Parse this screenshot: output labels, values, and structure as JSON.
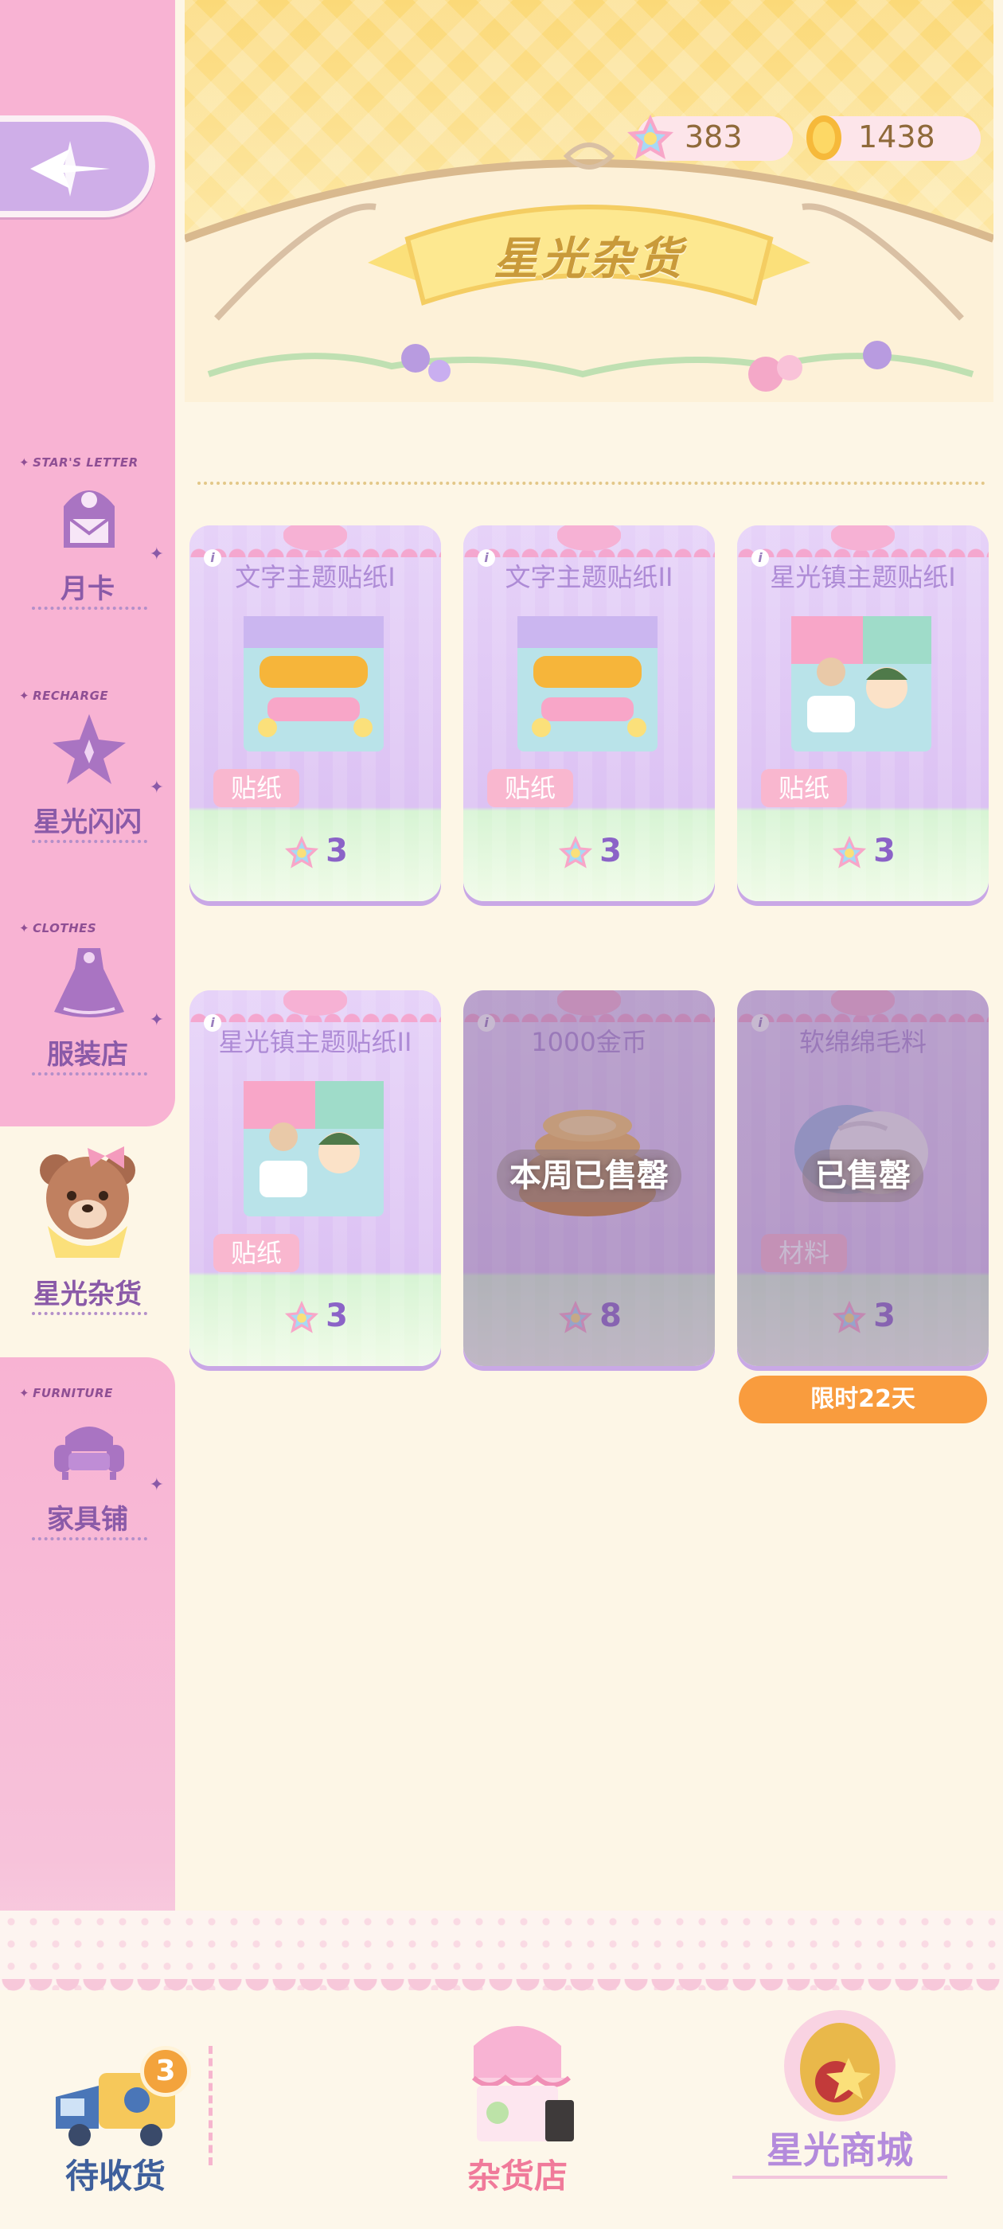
{
  "currency": {
    "stars": "383",
    "coins": "1438"
  },
  "banner": {
    "title": "星光杂货"
  },
  "sidebar": {
    "items": [
      {
        "tag": "STAR'S LETTER",
        "label": "月卡"
      },
      {
        "tag": "RECHARGE",
        "label": "星光闪闪"
      },
      {
        "tag": "CLOTHES",
        "label": "服装店"
      },
      {
        "tag": "",
        "label": "星光杂货"
      },
      {
        "tag": "FURNITURE",
        "label": "家具铺"
      }
    ]
  },
  "shop": {
    "items": [
      {
        "title": "文字主题贴纸I",
        "kind": "贴纸",
        "price": "3",
        "sold_out": false
      },
      {
        "title": "文字主题贴纸II",
        "kind": "贴纸",
        "price": "3",
        "sold_out": false
      },
      {
        "title": "星光镇主题贴纸I",
        "kind": "贴纸",
        "price": "3",
        "sold_out": false
      },
      {
        "title": "星光镇主题贴纸II",
        "kind": "贴纸",
        "price": "3",
        "sold_out": false
      },
      {
        "title": "1000金币",
        "kind": "",
        "price": "8",
        "sold_out": true,
        "sold_text": "本周已售罄"
      },
      {
        "title": "软绵绵毛料",
        "kind": "材料",
        "price": "3",
        "sold_out": true,
        "sold_text": "已售罄"
      }
    ],
    "limited_label": "限时22天"
  },
  "bottom_tabs": {
    "pending": {
      "label": "待收货",
      "badge": "3"
    },
    "store": {
      "label": "杂货店"
    },
    "mall": {
      "label": "星光商城"
    }
  },
  "colors": {
    "sidebar_pink": "#f8b3d3",
    "accent_purple": "#8a5aa8",
    "card_lilac": "#e0c9f5",
    "limited_orange": "#f99c3e",
    "banner_yellow": "#fbd978"
  }
}
